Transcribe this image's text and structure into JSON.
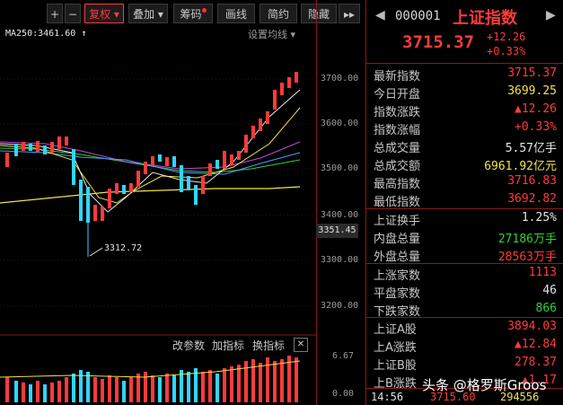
{
  "toolbar": {
    "plus": "+",
    "minus": "−",
    "fuquan": "复权",
    "diejia": "叠加",
    "chouma": "筹码",
    "huaxian": "画线",
    "jianyue": "简约",
    "yincang": "隐藏",
    "more": "▸▸"
  },
  "overlay": {
    "ma_label": "MA250:3461.60",
    "settings": "设置均线"
  },
  "axis": {
    "ticks": [
      "3700.00",
      "3600.00",
      "3500.00",
      "3400.00",
      "3300.00",
      "3200.00"
    ],
    "current_price": "3351.45",
    "low_label": "3312.72",
    "volume_ticks": [
      "6.67",
      "0.00"
    ]
  },
  "subtools": {
    "params": "改参数",
    "add_indicator": "加指标",
    "switch_indicator": "换指标",
    "close": "✕"
  },
  "quote": {
    "code": "000001",
    "name": "上证指数",
    "price": "3715.37",
    "change": "+12.26",
    "change_pct": "+0.33%",
    "rows": [
      {
        "label": "最新指数",
        "value": "3715.37",
        "color": "red"
      },
      {
        "label": "今日开盘",
        "value": "3699.25",
        "color": "yellow"
      },
      {
        "label": "指数涨跌",
        "value": "▲12.26",
        "color": "red"
      },
      {
        "label": "指数涨幅",
        "value": "+0.33%",
        "color": "red"
      },
      {
        "label": "总成交量",
        "value": "5.57亿手",
        "color": "white"
      },
      {
        "label": "总成交额",
        "value": "6961.92亿元",
        "color": "yellow"
      },
      {
        "label": "最高指数",
        "value": "3716.83",
        "color": "red"
      },
      {
        "label": "最低指数",
        "value": "3692.82",
        "color": "red"
      }
    ],
    "rows2": [
      {
        "label": "上证换手",
        "value": "1.25%",
        "color": "white"
      },
      {
        "label": "内盘总量",
        "value": "27186万手",
        "color": "green"
      },
      {
        "label": "外盘总量",
        "value": "28563万手",
        "color": "red"
      }
    ],
    "rows3": [
      {
        "label": "上涨家数",
        "value": "1113",
        "color": "red"
      },
      {
        "label": "平盘家数",
        "value": "46",
        "color": "white"
      },
      {
        "label": "下跌家数",
        "value": "866",
        "color": "green"
      }
    ],
    "rows4": [
      {
        "label": "上证A股",
        "value": "3894.03",
        "color": "red"
      },
      {
        "label": "上A涨跌",
        "value": "▲12.84",
        "color": "red"
      },
      {
        "label": "上证B股",
        "value": "278.37",
        "color": "red"
      },
      {
        "label": "上B涨跌",
        "value": "▲1.17",
        "color": "red"
      }
    ]
  },
  "bottom": {
    "time": "14:56",
    "price": "3715.60",
    "volume": "294556"
  },
  "watermark": "头条 @格罗斯Groos"
}
